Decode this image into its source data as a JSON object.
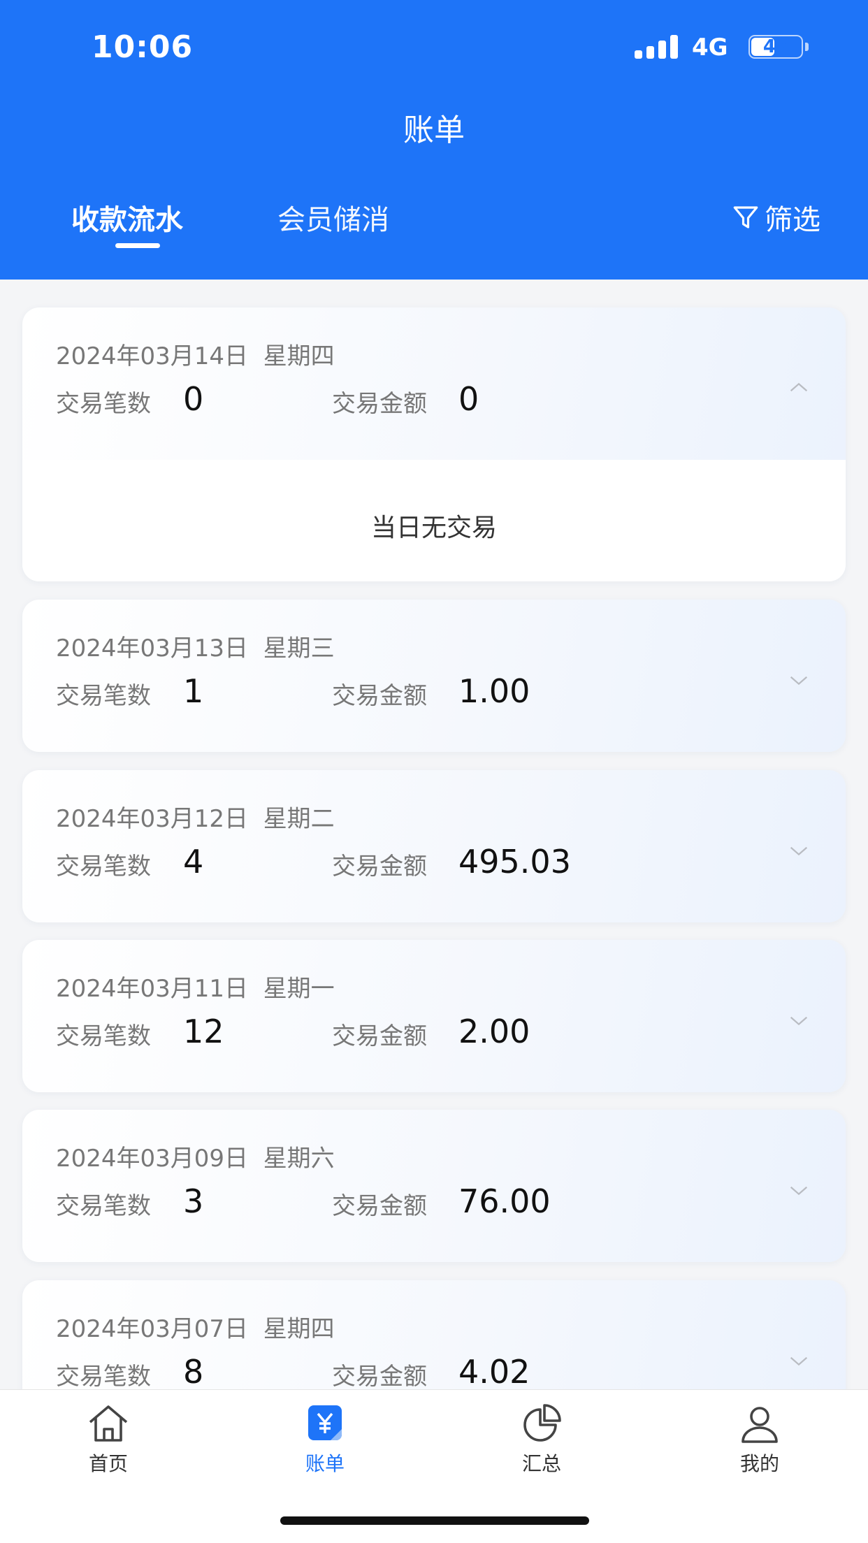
{
  "status_bar": {
    "time": "10:06",
    "network": "4G",
    "battery": "47",
    "battery_level": 0.47
  },
  "header": {
    "title": "账单",
    "tabs": [
      {
        "label": "收款流水",
        "active": true
      },
      {
        "label": "会员储消",
        "active": false
      }
    ],
    "filter_label": "筛选"
  },
  "labels": {
    "count": "交易笔数",
    "amount": "交易金额",
    "empty": "当日无交易"
  },
  "days": [
    {
      "date": "2024年03月14日",
      "weekday": "星期四",
      "count": "0",
      "amount": "0",
      "expanded": true
    },
    {
      "date": "2024年03月13日",
      "weekday": "星期三",
      "count": "1",
      "amount": "1.00",
      "expanded": false
    },
    {
      "date": "2024年03月12日",
      "weekday": "星期二",
      "count": "4",
      "amount": "495.03",
      "expanded": false
    },
    {
      "date": "2024年03月11日",
      "weekday": "星期一",
      "count": "12",
      "amount": "2.00",
      "expanded": false
    },
    {
      "date": "2024年03月09日",
      "weekday": "星期六",
      "count": "3",
      "amount": "76.00",
      "expanded": false
    },
    {
      "date": "2024年03月07日",
      "weekday": "星期四",
      "count": "8",
      "amount": "4.02",
      "expanded": false
    }
  ],
  "bottom_nav": [
    {
      "label": "首页",
      "icon": "home-icon",
      "active": false
    },
    {
      "label": "账单",
      "icon": "bill-icon",
      "active": true
    },
    {
      "label": "汇总",
      "icon": "pie-chart-icon",
      "active": false
    },
    {
      "label": "我的",
      "icon": "user-icon",
      "active": false
    }
  ],
  "colors": {
    "brand": "#1e74f8",
    "background": "#f4f5f7"
  }
}
